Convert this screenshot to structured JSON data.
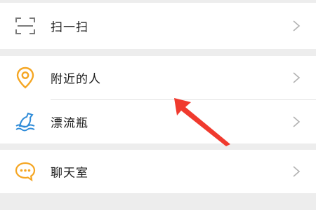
{
  "menu": {
    "group1": {
      "items": [
        {
          "label": "扫一扫",
          "icon": "scan-icon"
        }
      ]
    },
    "group2": {
      "items": [
        {
          "label": "附近的人",
          "icon": "location-pin-icon"
        },
        {
          "label": "漂流瓶",
          "icon": "drift-bottle-icon"
        }
      ]
    },
    "group3": {
      "items": [
        {
          "label": "聊天室",
          "icon": "chat-bubble-icon"
        }
      ]
    }
  },
  "colors": {
    "background": "#ededed",
    "row": "#ffffff",
    "accent_orange": "#f5a623",
    "accent_blue": "#2e8bd8",
    "annotation_red": "#f03a2e",
    "chevron": "#b2b2b2"
  }
}
